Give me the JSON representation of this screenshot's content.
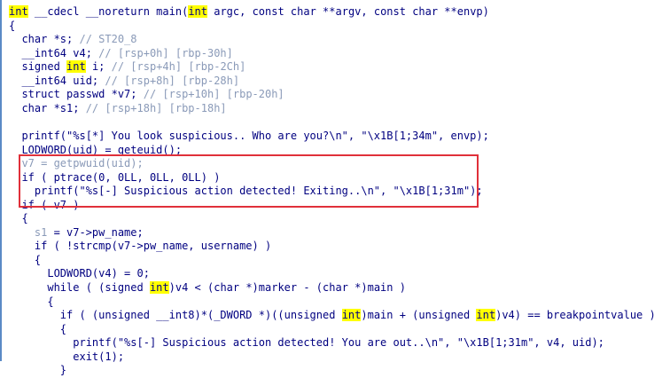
{
  "lines": [
    [
      {
        "t": "int",
        "c": "hl"
      },
      {
        "t": " __cdecl __noreturn main("
      },
      {
        "t": "int",
        "c": "hl"
      },
      {
        "t": " argc, const char **argv, const char **envp)"
      }
    ],
    [
      {
        "t": "{"
      }
    ],
    [
      {
        "t": "  char *s; "
      },
      {
        "t": "// ST20_8",
        "c": "cm"
      }
    ],
    [
      {
        "t": "  __int64 v4; "
      },
      {
        "t": "// [rsp+0h] [rbp-30h]",
        "c": "cm"
      }
    ],
    [
      {
        "t": "  signed "
      },
      {
        "t": "int",
        "c": "hl"
      },
      {
        "t": " i; "
      },
      {
        "t": "// [rsp+4h] [rbp-2Ch]",
        "c": "cm"
      }
    ],
    [
      {
        "t": "  __int64 uid; "
      },
      {
        "t": "// [rsp+8h] [rbp-28h]",
        "c": "cm"
      }
    ],
    [
      {
        "t": "  struct passwd *v7; "
      },
      {
        "t": "// [rsp+10h] [rbp-20h]",
        "c": "cm"
      }
    ],
    [
      {
        "t": "  char *s1; "
      },
      {
        "t": "// [rsp+18h] [rbp-18h]",
        "c": "cm"
      }
    ],
    [
      {
        "t": ""
      }
    ],
    [
      {
        "t": "  printf(\"%s[*] You look suspicious.. Who are you?\\n\", \"\\x1B[1;34m\", envp);"
      }
    ],
    [
      {
        "t": "  LODWORD(uid) = geteuid();"
      }
    ],
    [
      {
        "t": "  v7 = getpwuid(uid);",
        "c": "cm"
      }
    ],
    [
      {
        "t": "  if ( ptrace(0, 0LL, 0LL, 0LL) )"
      }
    ],
    [
      {
        "t": "    printf(\"%s[-] Suspicious action detected! Exiting..\\n\", \"\\x1B[1;31m\");"
      }
    ],
    [
      {
        "t": "  if ( v7 )"
      }
    ],
    [
      {
        "t": "  {"
      }
    ],
    [
      {
        "t": "    "
      },
      {
        "t": "s1",
        "c": "cm"
      },
      {
        "t": " = v7->pw_name;"
      }
    ],
    [
      {
        "t": "    if ( !strcmp(v7->pw_name, username) )"
      }
    ],
    [
      {
        "t": "    {"
      }
    ],
    [
      {
        "t": "      LODWORD(v4) = 0;"
      }
    ],
    [
      {
        "t": "      while ( (signed "
      },
      {
        "t": "int",
        "c": "hl"
      },
      {
        "t": ")v4 < (char *)marker - (char *)main )"
      }
    ],
    [
      {
        "t": "      {"
      }
    ],
    [
      {
        "t": "        if ( (unsigned __int8)*(_DWORD *)((unsigned "
      },
      {
        "t": "int",
        "c": "hl"
      },
      {
        "t": ")main + (unsigned "
      },
      {
        "t": "int",
        "c": "hl"
      },
      {
        "t": ")v4) == breakpointvalue )"
      }
    ],
    [
      {
        "t": "        {"
      }
    ],
    [
      {
        "t": "          printf(\"%s[-] Suspicious action detected! You are out..\\n\", \"\\x1B[1;31m\", v4, uid);"
      }
    ],
    [
      {
        "t": "          exit(1);"
      }
    ],
    [
      {
        "t": "        }"
      }
    ]
  ]
}
